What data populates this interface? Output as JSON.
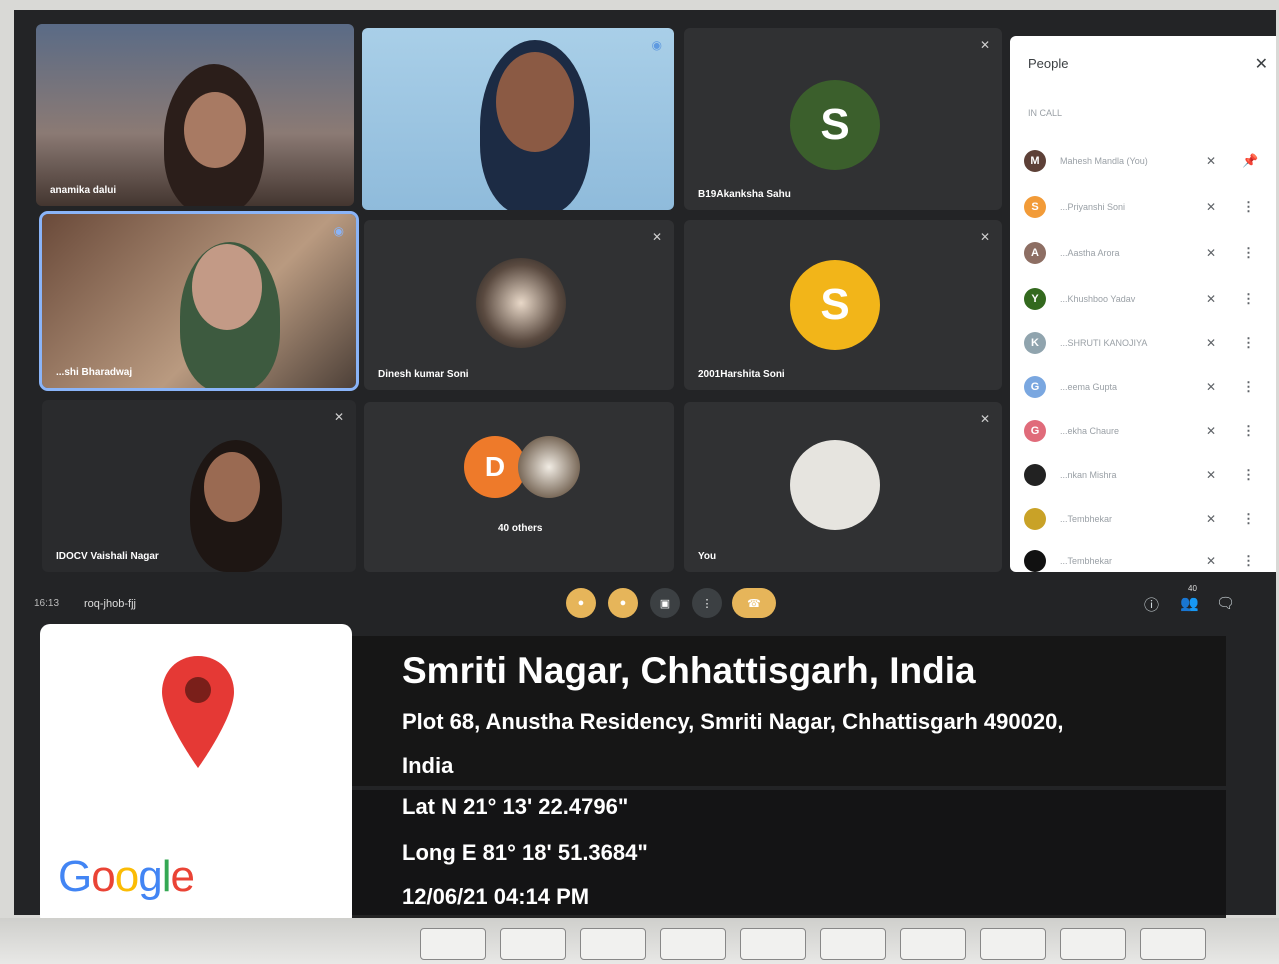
{
  "meet": {
    "tiles": [
      {
        "name": "anamika dalui"
      },
      {
        "name": ""
      },
      {
        "name": "B19Akanksha Sahu",
        "initial": "S"
      },
      {
        "name": "...shi Bharadwaj"
      },
      {
        "name": "Dinesh kumar Soni"
      },
      {
        "name": "2001Harshita Soni",
        "initial": "S"
      },
      {
        "name": "IDOCV Vaishali Nagar"
      },
      {
        "name": "40 others",
        "initial": "D"
      },
      {
        "name": "You"
      }
    ],
    "meeting_time": "16:13",
    "meeting_code": "roq-jhob-fjj",
    "participant_count": "40"
  },
  "people_panel": {
    "title": "People",
    "section_label": "IN CALL",
    "participants": [
      {
        "initial": "M",
        "name": "Mahesh Mandla (You)",
        "color": "#5d4037"
      },
      {
        "initial": "S",
        "name": "...Priyanshi Soni",
        "color": "#f29b38"
      },
      {
        "initial": "A",
        "name": "...Aastha Arora",
        "color": "#8d6e63"
      },
      {
        "initial": "Y",
        "name": "...Khushboo Yadav",
        "color": "#33691e"
      },
      {
        "initial": "K",
        "name": "...SHRUTI KANOJIYA",
        "color": "#90a4ae"
      },
      {
        "initial": "G",
        "name": "...eema Gupta",
        "color": "#7aa7e0"
      },
      {
        "initial": "G",
        "name": "...ekha Chaure",
        "color": "#e06b7a"
      },
      {
        "initial": "",
        "name": "...nkan Mishra",
        "color": "#222222"
      },
      {
        "initial": "",
        "name": "...Tembhekar",
        "color": "#c9a227"
      },
      {
        "initial": "",
        "name": "...Tembhekar",
        "color": "#111111"
      }
    ]
  },
  "geotag": {
    "brand": "Google",
    "place": "Smriti Nagar, Chhattisgarh, India",
    "address_line1": "Plot 68, Anustha Residency, Smriti Nagar, Chhattisgarh 490020,",
    "address_line2": "India",
    "latitude": "Lat N 21° 13' 22.4796\"",
    "longitude": "Long E 81° 18' 51.3684\"",
    "datetime": "12/06/21 04:14 PM"
  },
  "colors": {
    "pin_red": "#e53935",
    "google_blue": "#4285f4",
    "google_red": "#ea4335",
    "google_yellow": "#fbbc05",
    "google_green": "#34a853"
  }
}
